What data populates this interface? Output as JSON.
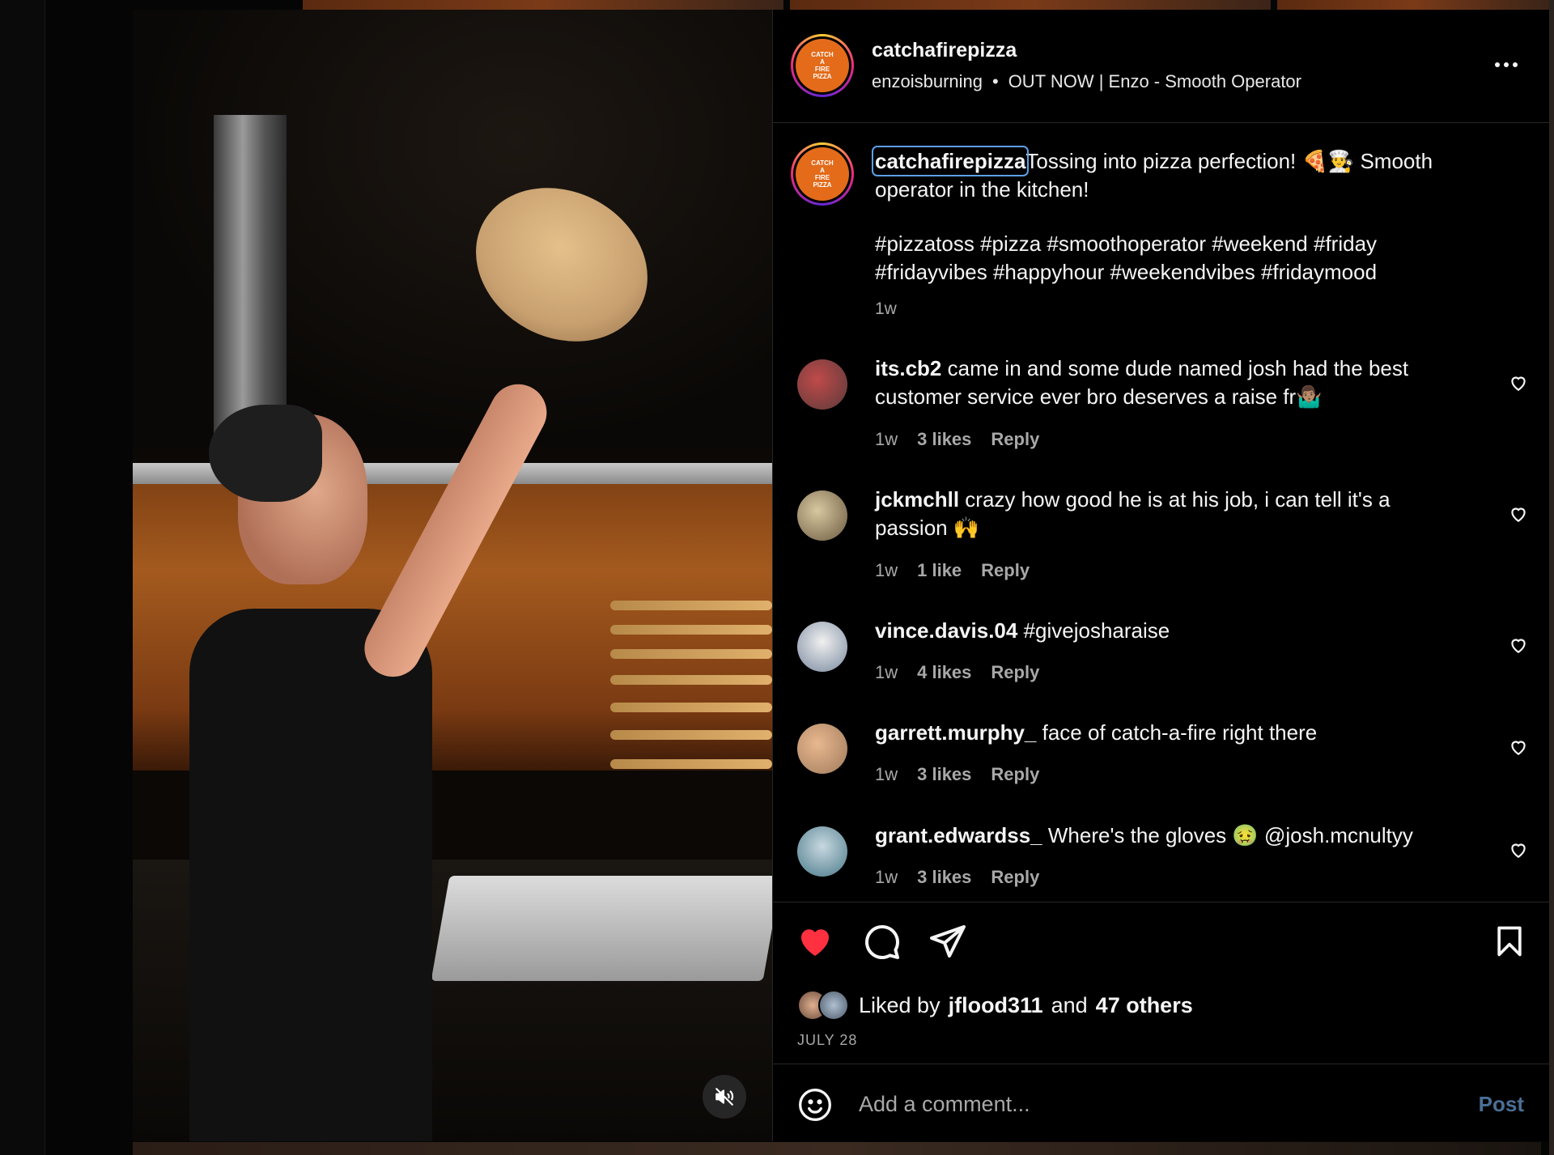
{
  "post": {
    "author": "catchafirepizza",
    "audio_artist": "enzoisburning",
    "audio_separator": "•",
    "audio_track": "OUT NOW | Enzo - Smooth Operator",
    "logo_text": [
      "CATCH",
      "A",
      "FIRE",
      "PIZZA"
    ]
  },
  "caption": {
    "username": "catchafirepizza",
    "text": "Tossing into pizza perfection! 🍕👨‍🍳 Smooth operator in the kitchen!",
    "hashtags": "#pizzatoss #pizza #smoothoperator #weekend #friday #fridayvibes #happyhour #weekendvibes #fridaymood",
    "time": "1w"
  },
  "comments": [
    {
      "username": "its.cb2",
      "text": "came in and some dude named josh had the best customer service ever bro deserves a raise fr🤷🏽‍♂️",
      "time": "1w",
      "likes": "3 likes",
      "reply": "Reply",
      "avatar_color": "#5a3a3a"
    },
    {
      "username": "jckmchll",
      "text": "crazy how good he is at his job, i can tell it's a passion 🙌",
      "time": "1w",
      "likes": "1 like",
      "reply": "Reply",
      "avatar_color": "#6a5a40"
    },
    {
      "username": "vince.davis.04",
      "text": "#givejosharaise",
      "time": "1w",
      "likes": "4 likes",
      "reply": "Reply",
      "avatar_color": "#7a8aa0"
    },
    {
      "username": "garrett.murphy_",
      "text": "face of catch-a-fire right there",
      "time": "1w",
      "likes": "3 likes",
      "reply": "Reply",
      "avatar_color": "#a07a5a"
    },
    {
      "username": "grant.edwardss_",
      "text": "Where's the gloves 🤢 @josh.mcnultyy",
      "time": "1w",
      "likes": "3 likes",
      "reply": "Reply",
      "avatar_color": "#4a7a8a"
    }
  ],
  "likes": {
    "prefix": "Liked by",
    "user": "jflood311",
    "middle": "and",
    "others": "47 others"
  },
  "date": "JULY 28",
  "add_comment": {
    "placeholder": "Add a comment...",
    "post_label": "Post"
  },
  "colors": {
    "accent_blue": "#4a6f96",
    "heart_red": "#ff3040",
    "brand_orange": "#e36b1a"
  },
  "icons": [
    "more-icon",
    "heart-icon",
    "comment-icon",
    "share-icon",
    "bookmark-icon",
    "emoji-icon",
    "mute-icon"
  ]
}
